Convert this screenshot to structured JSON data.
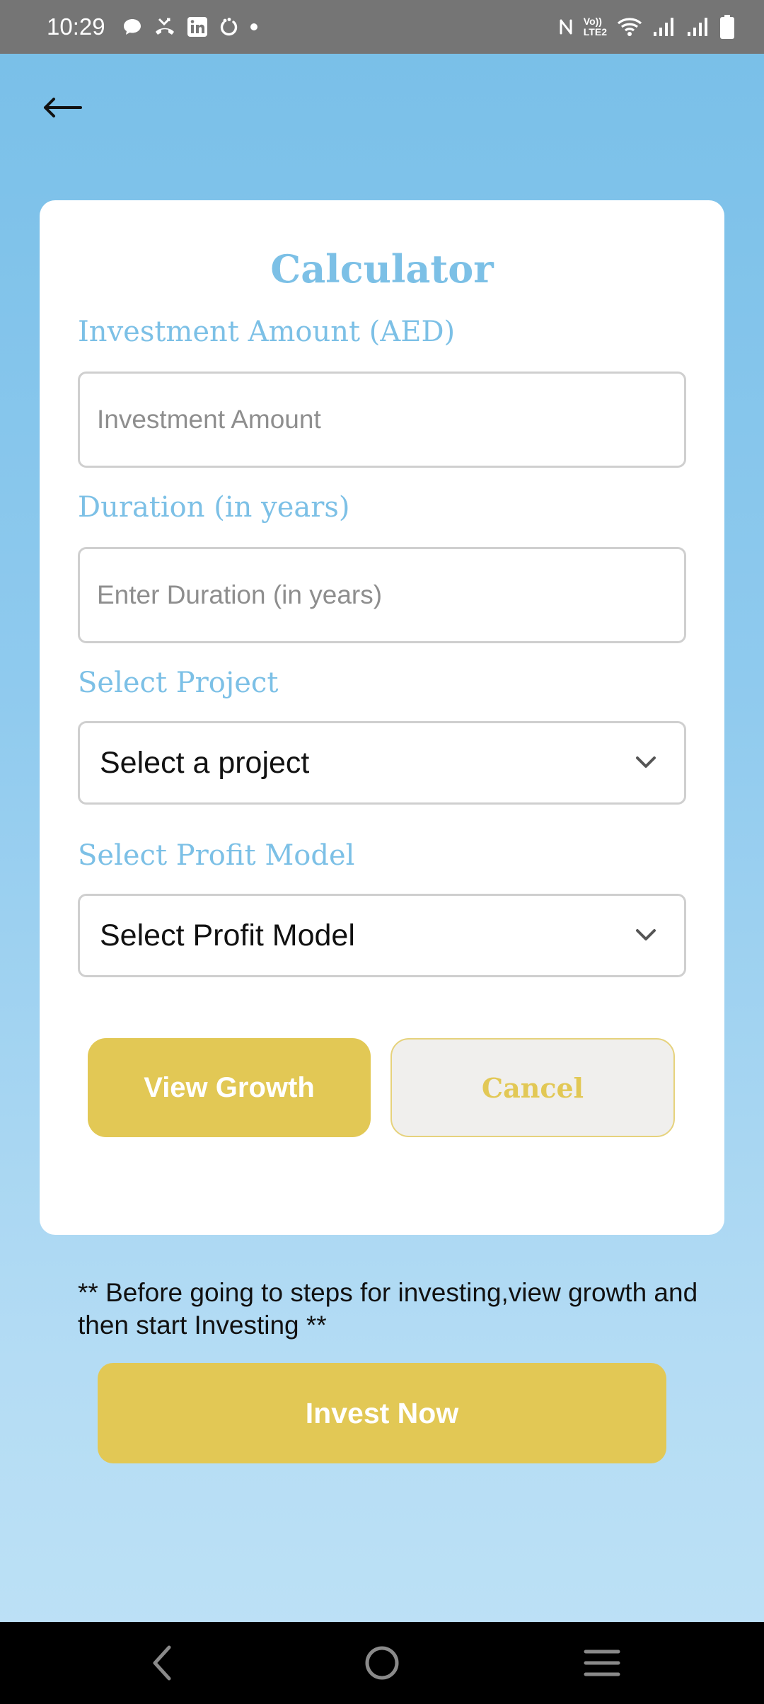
{
  "status_bar": {
    "time": "10:29",
    "left_icons": [
      "chat-icon",
      "missed-call-icon",
      "linkedin-icon",
      "sync-icon",
      "dot-icon"
    ],
    "right_icons": [
      "nfc-icon",
      "volte-icon",
      "wifi-icon",
      "signal-icon",
      "signal-2-icon",
      "battery-icon"
    ],
    "volte_line1": "Vo))",
    "volte_line2": "LTE2"
  },
  "header": {
    "back_icon": "arrow-left-icon"
  },
  "calculator": {
    "title": "Calculator",
    "investment_label": "Investment Amount (AED)",
    "investment_placeholder": "Investment Amount",
    "investment_value": "",
    "duration_label": "Duration (in years)",
    "duration_placeholder": "Enter Duration (in years)",
    "duration_value": "",
    "project_label": "Select Project",
    "project_selected": "Select a project",
    "profit_label": "Select Profit Model",
    "profit_selected": "Select Profit Model",
    "view_growth_label": "View Growth",
    "cancel_label": "Cancel"
  },
  "footer": {
    "note": "** Before going to steps for investing,view growth and then start Investing **",
    "invest_label": "Invest Now"
  },
  "nav_bar": {
    "icons": [
      "nav-back-icon",
      "nav-home-icon",
      "nav-recents-icon"
    ]
  },
  "colors": {
    "accent_blue": "#7cc0e6",
    "accent_gold": "#e2c855",
    "status_bar": "#757575",
    "background_top": "#78bfe8",
    "background_bottom": "#bee2f6"
  }
}
